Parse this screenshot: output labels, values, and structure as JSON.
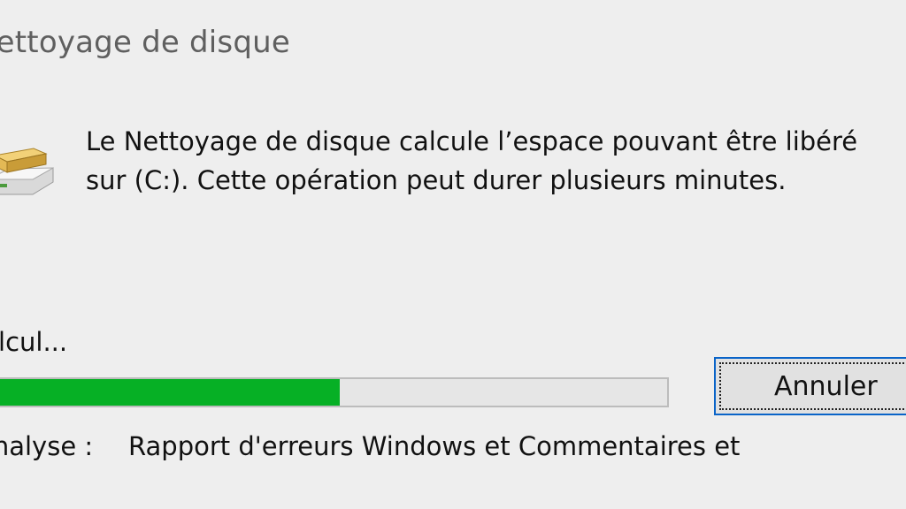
{
  "window": {
    "title": "Nettoyage de disque"
  },
  "message": {
    "line1": "Le Nettoyage de disque calcule l’espace pouvant être libéré",
    "line2": "sur  (C:). Cette opération peut durer plusieurs minutes."
  },
  "status": {
    "text": "Calcul...",
    "progress_fraction": 0.51
  },
  "buttons": {
    "cancel_label": "Annuler"
  },
  "analysis": {
    "label": "Analyse :",
    "value": "Rapport d'erreurs Windows et Commentaires et"
  },
  "icons": {
    "main": "disk-cleanup-icon"
  },
  "colors": {
    "progress": "#06b025",
    "title": "#5f5f5f",
    "focus": "#0a64c8"
  }
}
